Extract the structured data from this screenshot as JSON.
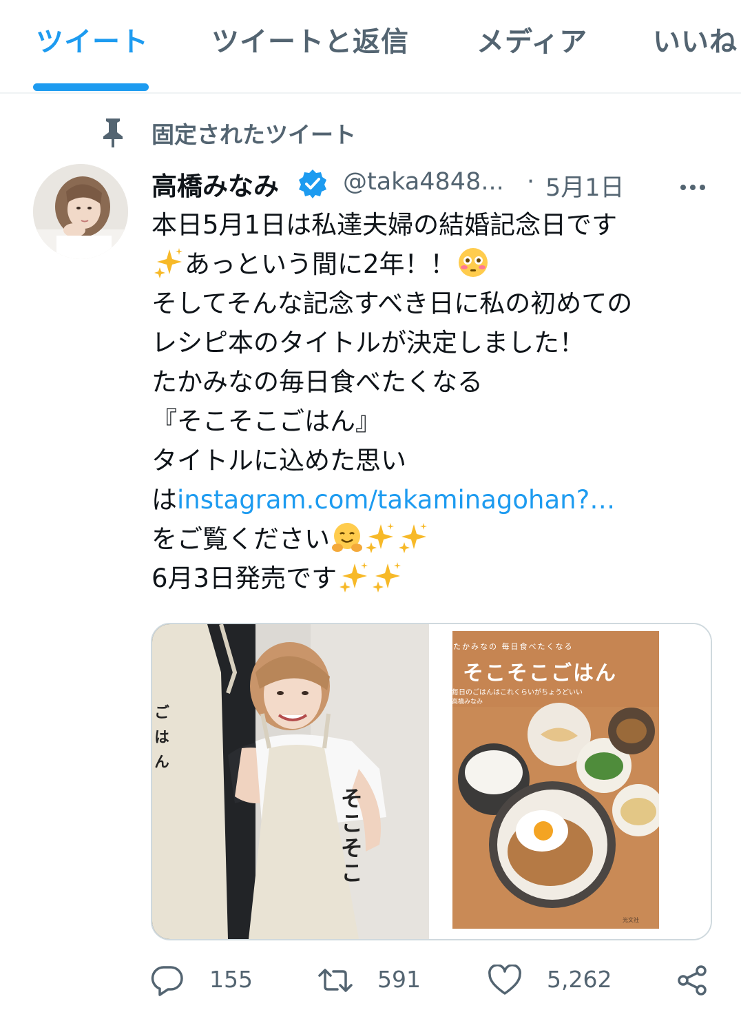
{
  "tabs": [
    {
      "label": "ツイート",
      "active": true
    },
    {
      "label": "ツイートと返信",
      "active": false
    },
    {
      "label": "メディア",
      "active": false
    },
    {
      "label": "いいね",
      "active": false
    }
  ],
  "pinned": {
    "label": "固定されたツイート",
    "icon": "pin-icon"
  },
  "tweet": {
    "author": {
      "display_name": "高橋みなみ",
      "handle": "@taka4848...",
      "verified": true
    },
    "separator": "·",
    "timestamp": "5月1日",
    "body": {
      "line1": "本日5月1日は私達夫婦の結婚記念日です",
      "line2_text": "あっという間に2年！！",
      "line3": "そしてそんな記念すべき日に私の初めての",
      "line4": "レシピ本のタイトルが決定しました！",
      "line5": "たかみなの毎日食べたくなる",
      "line6": "『そこそこごはん』",
      "line7": "タイトルに込めた思い",
      "line8_prefix": "は",
      "link": "instagram.com/takaminagohan?…",
      "line9_text": "をご覧ください",
      "line10_text": "6月3日発売です"
    },
    "media": {
      "left_photo": {
        "apron_text": "そこそこ",
        "apron_text_2": "ごはん"
      },
      "right_photo": {
        "book_small": "たかみなの 毎日食べたくなる",
        "book_title": "そこそこごはん",
        "book_subtitle": "毎日のごはんはこれくらいがちょうどいい",
        "book_author": "高橋みなみ",
        "book_publisher": "光文社"
      }
    },
    "actions": {
      "reply": {
        "count": "155",
        "icon": "reply-icon"
      },
      "retweet": {
        "count": "591",
        "icon": "retweet-icon"
      },
      "like": {
        "count": "5,262",
        "icon": "heart-icon"
      },
      "share": {
        "icon": "share-icon"
      }
    },
    "colors": {
      "accent": "#1d9bf0",
      "secondary_text": "#536471",
      "border": "#cfd9de"
    }
  }
}
